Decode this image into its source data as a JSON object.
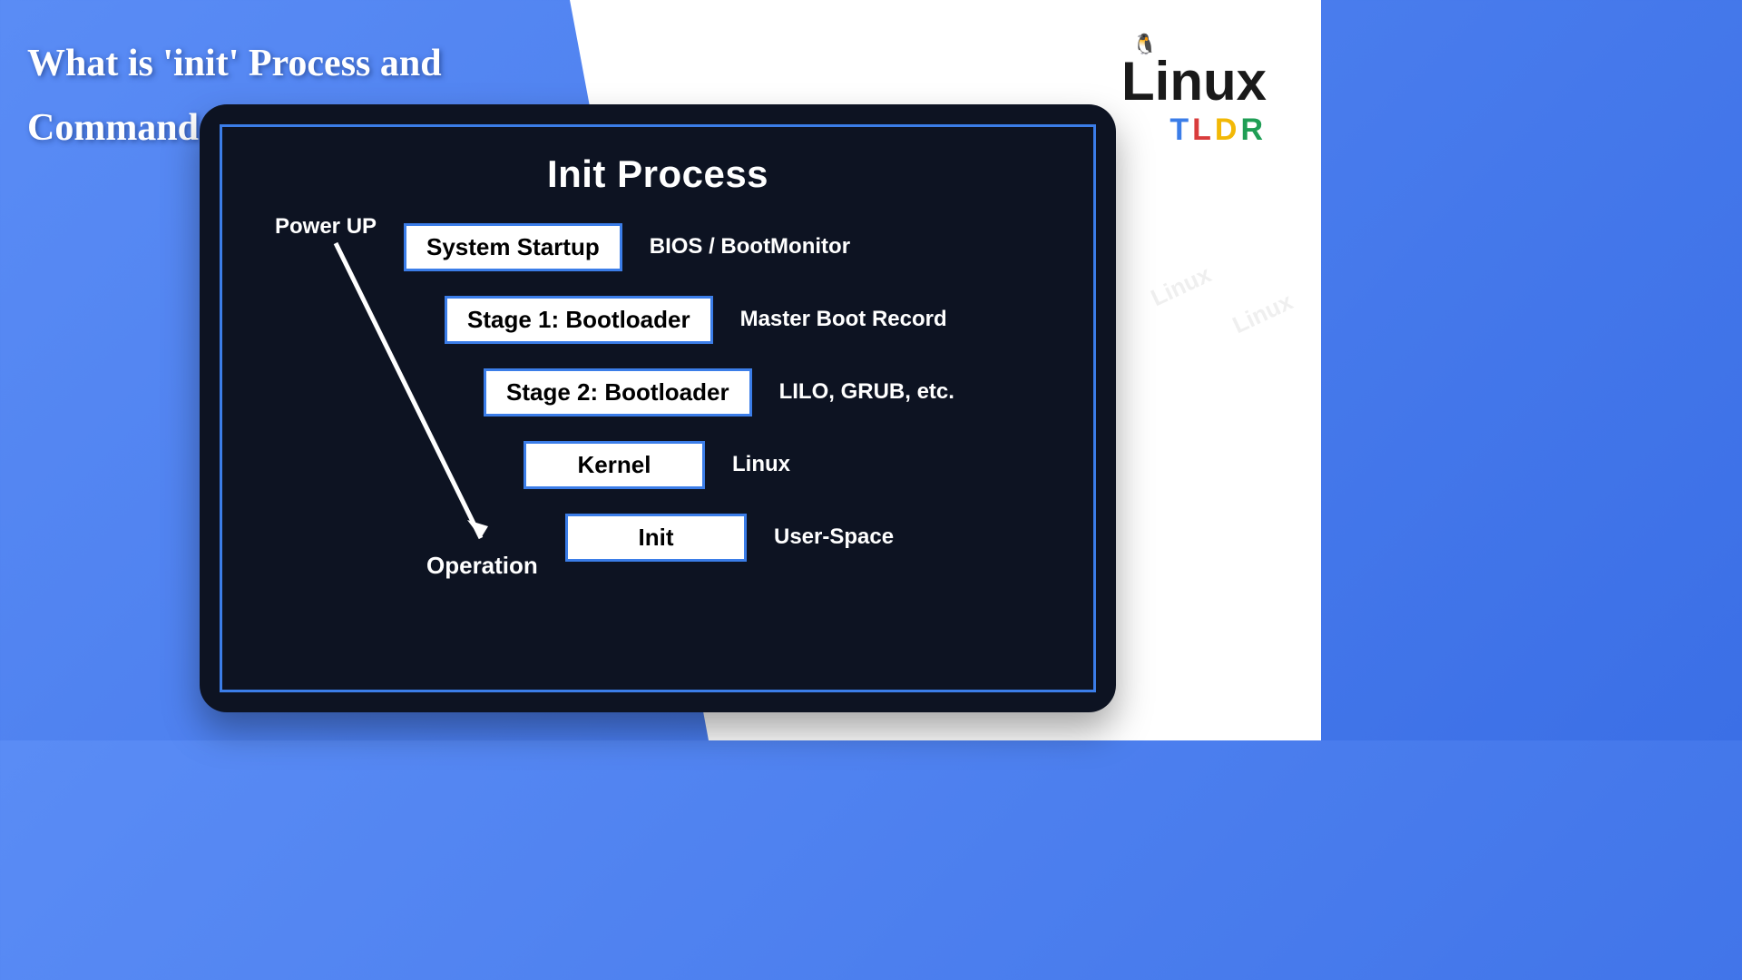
{
  "page_title": "What is 'init' Process and Command in Linux?",
  "logo": {
    "line1": "Linux",
    "t": "T",
    "l": "L",
    "d": "D",
    "r": "R"
  },
  "diagram": {
    "title": "Init Process",
    "arrow_start_label": "Power UP",
    "arrow_end_label": "Operation",
    "stages": [
      {
        "label": "System Startup",
        "desc": "BIOS / BootMonitor",
        "offset": 0
      },
      {
        "label": "Stage 1: Bootloader",
        "desc": "Master Boot Record",
        "offset": 45
      },
      {
        "label": "Stage 2: Bootloader",
        "desc": "LILO, GRUB, etc.",
        "offset": 88
      },
      {
        "label": "Kernel",
        "desc": "Linux",
        "offset": 132
      },
      {
        "label": "Init",
        "desc": "User-Space",
        "offset": 178
      }
    ]
  },
  "watermark": "Linux"
}
